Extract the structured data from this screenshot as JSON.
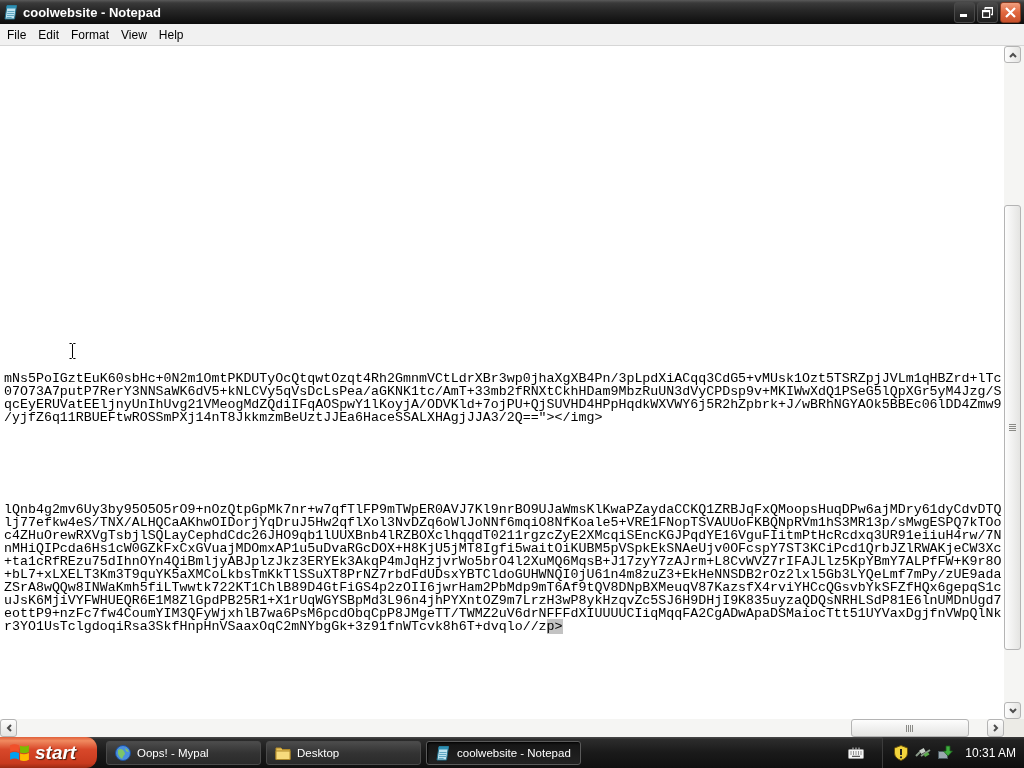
{
  "window": {
    "title": "coolwebsite - Notepad"
  },
  "menu": [
    "File",
    "Edit",
    "Format",
    "View",
    "Help"
  ],
  "editor": {
    "blocks": [
      {
        "lines": [
          {
            "text": "mNs5PoIGztEuK60sbHc+0N2m1OmtPKDUTyOcQtqwtOzqt4Rh2GmnmVCtLdrXBr3wp0jhaXgXB4Pn/3pLpdXiACqq3CdG5+vMUsk1Ozt5TSRZpjJVLm1qHBZrd+lTc"
          },
          {
            "text": "07O73A7putP7RerY3NNSaWK6dV5+kNLCVy5qVsDcLsPea/aGKNK1tc/AmT+33mb2fRNXtCkhHDam9MbzRuUN3dVyCPDsp9v+MKIWwXdQ1PSeG5lQpXGr5yM4Jzg/S"
          },
          {
            "text": "qcEyERUVatEEljnyUnIhUvg21VMeogMdZQdiIFqAOSpwY1lKoyjA/ODVKld+7ojPU+QjSUVHD4HPpHqdkWXVWY6j5R2hZpbrk+J/wBRhNGYAOk5BBEc06lDD4Zmw9"
          },
          {
            "text": "/yjfZ6q11RBUEFtwROSSmPXj14nT8JkkmzmBeUztJJEa6HaceSSALXHAgjJJA3/2Q==\"></img>"
          }
        ]
      },
      {
        "lines": [
          {
            "text": "lQnb4g2mv6Uy3by95O5O5rO9+nOzQtpGpMk7nr+w7qfTlFP9mTWpER0AVJ7Kl9nrBO9UJaWmsKlKwaPZaydaCCKQ1ZRBJqFxQMoopsHuqDPw6ajMDry61dyCdvDTQ"
          },
          {
            "text": "lj77efkw4eS/TNX/ALHQCaAKhwOIDorjYqDruJ5Hw2qflXol3NvDZq6oWlJoNNf6mqiO8NfKoale5+VRE1FNopTSVAUUoFKBQNpRVm1hS3MR13p/sMwgESPQ7kTOo"
          },
          {
            "text": "c4ZHuOrewRXVgTsbjlSQLayCephdCdc26JHO9qb1lUUXBnb4lRZBOXclhqqdT0211rgzcZyE2XMcqiSEncKGJPqdYE16VguFIitmPtHcRcdxq3UR91eiiuH4rw/7N"
          },
          {
            "text": "nMHiQIPcda6Hs1cW0GZkFxCxGVuajMDOmxAP1u5uDvaRGcDOX+H8KjU5jMT8Igfi5waitOiKUBM5pVSpkEkSNAeUjv0OFcspY7ST3KCiPcd1QrbJZlRWAKjeCW3Xc"
          },
          {
            "text": "+ta1cRfREzu75dIhnOYn4QiBmljyABJplzJkz3ERYEk3AkqP4mJqHzjvrWo5brO4l2XuMQ6MqsB+J17zyY7zAJrm+L8CvWVZ7rIFAJLlz5KpYBmY7ALPfFW+K9r8O"
          },
          {
            "text": "+bL7+xLXELT3Km3T9quYK5aXMCoLkbsTmKkTlSSuXT8PrNZ7rbdFdUDsxYBTCldoGUHWNQI0jU61n4m8zuZ3+EkHeNNSDB2rOz2lxl5Gb3LYQeLmf7mPy/zUE9ada"
          },
          {
            "text": "ZSrA8wQQw8INWaKmh5fiLTwwtk722KT1ChlB89D4GtFiGS4p2zOII6jwrHam2PbMdp9mT6Af9tQV8DNpBXMeuqV87KazsfX4rviYHCcQGsvbYkSFZfHQx6gepqS1c"
          },
          {
            "text": "uJsK6MjiVYFWHUEQR6E1M8ZlGpdPB25R1+X1rUqWGYSBpMd3L96n4jhPYXntOZ9m7LrzH3wP8ykHzqvZc5SJ6H9DHjI9K835uyzaQDQsNRHLSdP81E6lnUMDnUgd7"
          },
          {
            "text": "eottP9+nzFc7fw4CoumYIM3QFyWjxhlB7wa6PsM6pcdObqCpP8JMgeTT/TWMZ2uV6drNFFFdXIUUUUCIiqMqqFA2CgADwApaDSMaiocTtt51UYVaxDgjfnVWpQlNk"
          },
          {
            "text": "r3YO1UsTclgdoqiRsa3SkfHnpHnVSaaxOqC2mNYbgGk+3z91fnWTcvk8h6T+dvqlo//z",
            "selected_text": "p>"
          }
        ]
      }
    ]
  },
  "taskbar": {
    "start_label": "start",
    "tasks": [
      {
        "label": "Oops! - Mypal",
        "kind": "browser",
        "selected": false
      },
      {
        "label": "Desktop",
        "kind": "folder",
        "selected": false
      },
      {
        "label": "coolwebsite - Notepad",
        "kind": "notepad",
        "selected": true
      }
    ],
    "clock": "10:31 AM"
  }
}
